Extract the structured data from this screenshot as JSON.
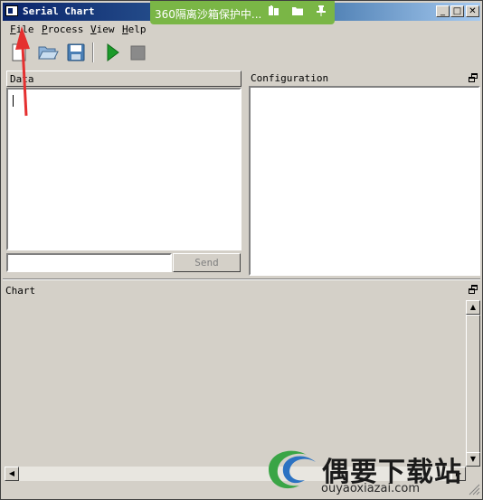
{
  "window": {
    "title": "Serial Chart",
    "minimize": "_",
    "maximize": "□",
    "close": "✕"
  },
  "overlay": {
    "text": "360隔离沙箱保护中..."
  },
  "menu": [
    {
      "first": "F",
      "rest": "ile"
    },
    {
      "first": "P",
      "rest": "rocess"
    },
    {
      "first": "V",
      "rest": "iew"
    },
    {
      "first": "H",
      "rest": "elp"
    }
  ],
  "panels": {
    "data_title": "Data",
    "config_title": "Configuration",
    "chart_title": "Chart",
    "send_label": "Send",
    "send_input_value": ""
  },
  "watermark": {
    "name": "偶要下载站",
    "url": "ouyaoxiazai.com"
  },
  "colors": {
    "titlebar_start": "#0a246a",
    "overlay_green": "#7ab646",
    "run_green": "#1b9a2a",
    "arrow_red": "#e53030"
  }
}
